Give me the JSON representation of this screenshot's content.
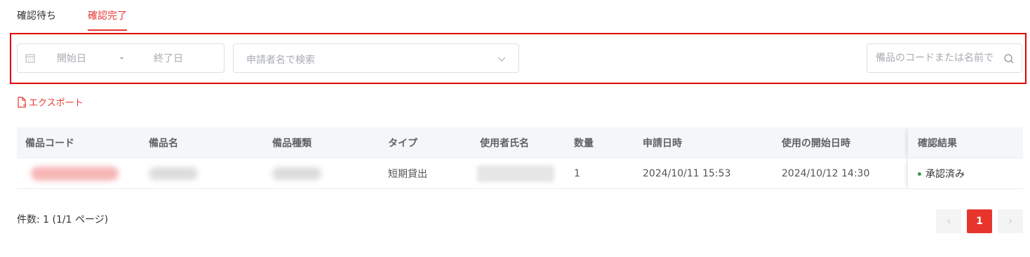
{
  "tabs": [
    {
      "label": "確認待ち",
      "active": false
    },
    {
      "label": "確認完了",
      "active": true
    }
  ],
  "filters": {
    "start_date_placeholder": "開始日",
    "date_separator": "-",
    "end_date_placeholder": "終了日",
    "applicant_placeholder": "申請者名で検索",
    "item_search_placeholder": "備品のコードまたは名前で"
  },
  "export_label": "エクスポート",
  "table": {
    "headers": [
      "備品コード",
      "備品名",
      "備品種類",
      "タイプ",
      "使用者氏名",
      "数量",
      "申請日時",
      "使用の開始日時",
      "確認結果"
    ],
    "rows": [
      {
        "type": "短期貸出",
        "quantity": "1",
        "applied_at": "2024/10/11 15:53",
        "start_at": "2024/10/12 14:30",
        "result": "承認済み"
      }
    ]
  },
  "pagination": {
    "summary": "件数: 1 (1/1 ページ)",
    "prev": "‹",
    "current": "1",
    "next": "›"
  },
  "colors": {
    "accent": "#e53935",
    "highlight_border": "#e00000",
    "status_approved": "#2e9f3f"
  },
  "icons": [
    "calendar-icon",
    "chevron-down-icon",
    "search-icon",
    "export-file-icon"
  ]
}
